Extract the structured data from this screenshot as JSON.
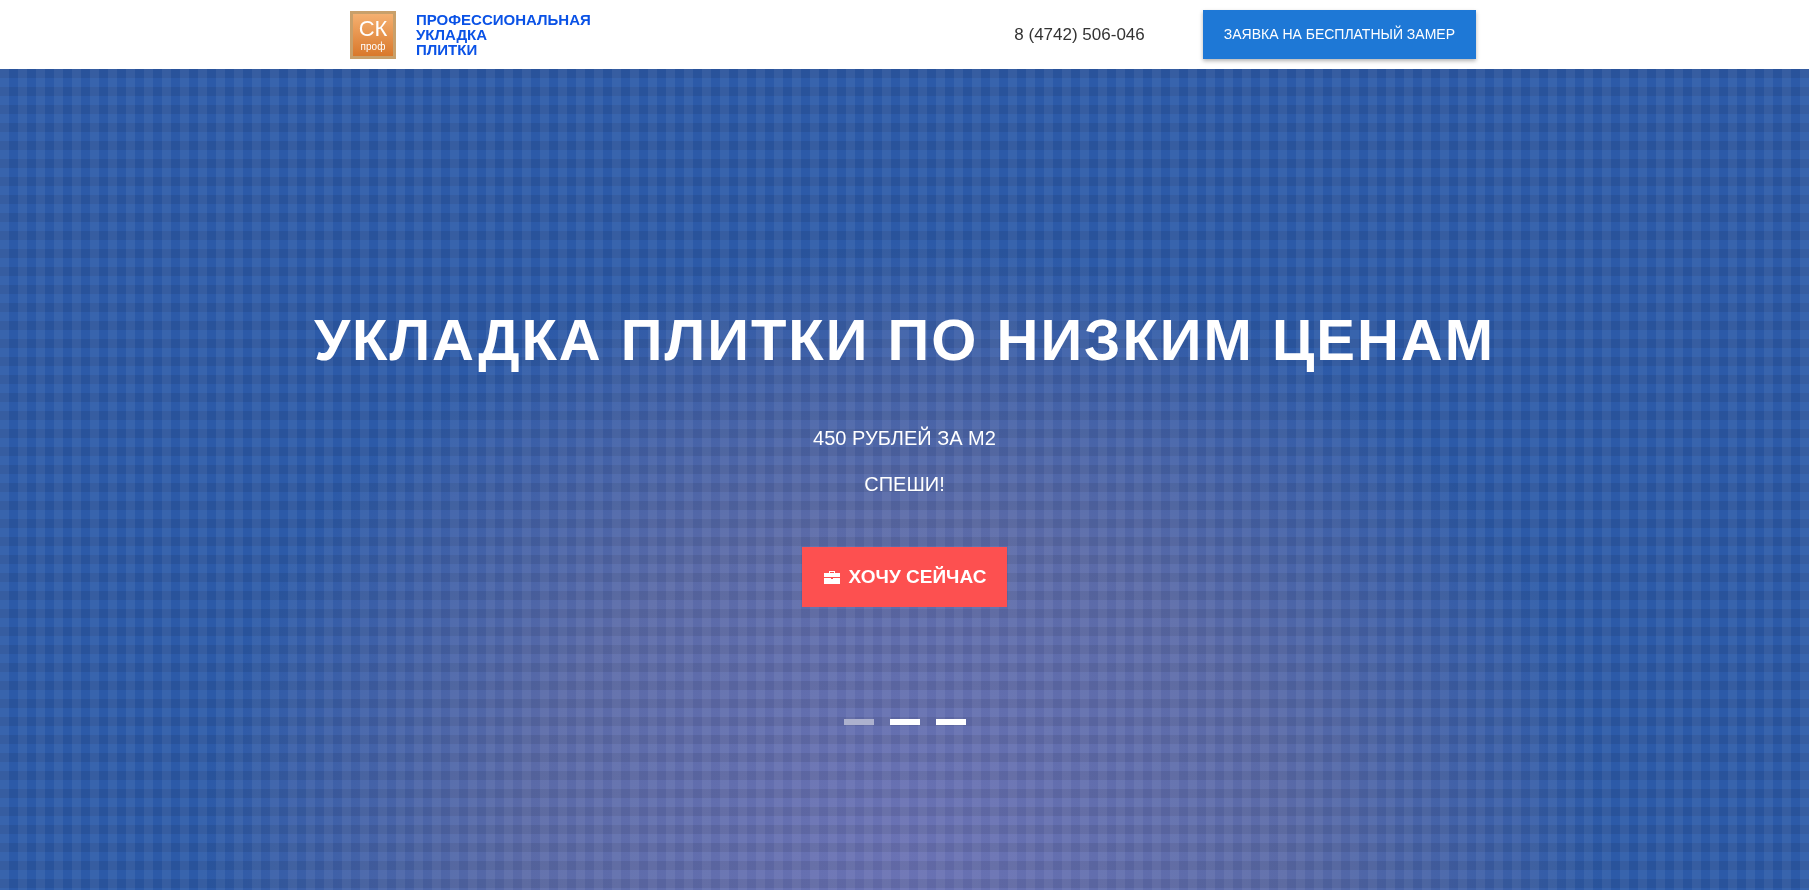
{
  "header": {
    "logo": {
      "letters": "СК",
      "caption": "проф"
    },
    "brand_lines": [
      "ПРОФЕССИОНАЛЬНАЯ",
      "УКЛАДКА",
      "ПЛИТКИ"
    ],
    "phone": "8 (4742) 506-046",
    "cta_button": "ЗАЯВКА НА БЕСПЛАТНЫЙ ЗАМЕР"
  },
  "hero": {
    "title": "УКЛАДКА ПЛИТКИ ПО НИЗКИМ ЦЕНАМ",
    "subtitle_lines": [
      "450 РУБЛЕЙ ЗА М2",
      "СПЕШИ!"
    ],
    "button": "ХОЧУ СЕЙЧАС",
    "indicators": [
      {
        "selected": true
      },
      {
        "selected": false
      },
      {
        "selected": false
      }
    ]
  }
}
